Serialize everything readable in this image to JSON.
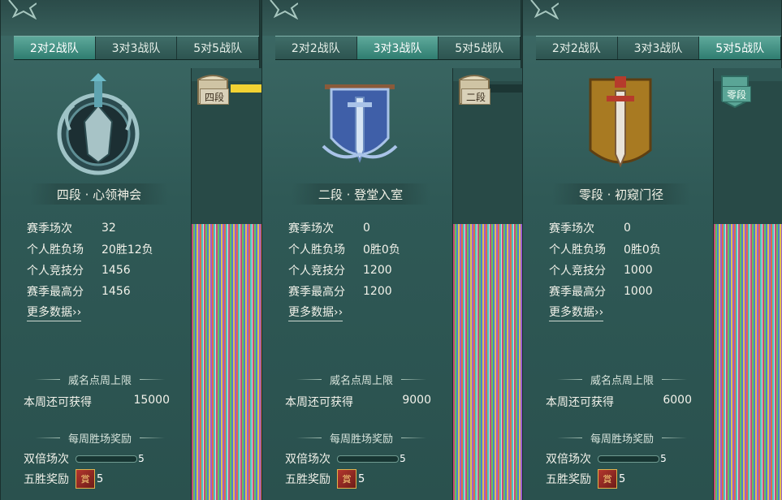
{
  "tabs": [
    "2对2战队",
    "3对3战队",
    "5对5战队"
  ],
  "panels": [
    {
      "active_tab": 0,
      "rank_title": "四段 · 心领神会",
      "emblem": "dark-crest-emblem",
      "chest_label": "四段",
      "stats": [
        {
          "label": "赛季场次",
          "value": "32"
        },
        {
          "label": "个人胜负场",
          "value": "20胜12负"
        },
        {
          "label": "个人竞技分",
          "value": "1456"
        },
        {
          "label": "赛季最高分",
          "value": "1456"
        }
      ],
      "more_link": "更多数据››",
      "weekly_cap_title": "威名点周上限",
      "weekly_remaining_label": "本周还可获得",
      "weekly_remaining_value": "15000",
      "weekly_reward_title": "每周胜场奖励",
      "double_label": "双倍场次",
      "double_progress": 0.0,
      "double_max": "5",
      "five_win_label": "五胜奖励",
      "reward_count": "5"
    },
    {
      "active_tab": 1,
      "rank_title": "二段 · 登堂入室",
      "emblem": "blue-banner-sword-emblem",
      "chest_label": "二段",
      "stats": [
        {
          "label": "赛季场次",
          "value": "0"
        },
        {
          "label": "个人胜负场",
          "value": "0胜0负"
        },
        {
          "label": "个人竞技分",
          "value": "1200"
        },
        {
          "label": "赛季最高分",
          "value": "1200"
        }
      ],
      "more_link": "更多数据››",
      "weekly_cap_title": "威名点周上限",
      "weekly_remaining_label": "本周还可获得",
      "weekly_remaining_value": "9000",
      "weekly_reward_title": "每周胜场奖励",
      "double_label": "双倍场次",
      "double_progress": 0.0,
      "double_max": "5",
      "five_win_label": "五胜奖励",
      "reward_count": "5"
    },
    {
      "active_tab": 2,
      "rank_title": "零段 · 初窥门径",
      "emblem": "gold-banner-sword-emblem",
      "chest_label": "零段",
      "stats": [
        {
          "label": "赛季场次",
          "value": "0"
        },
        {
          "label": "个人胜负场",
          "value": "0胜0负"
        },
        {
          "label": "个人竞技分",
          "value": "1000"
        },
        {
          "label": "赛季最高分",
          "value": "1000"
        }
      ],
      "more_link": "更多数据››",
      "weekly_cap_title": "威名点周上限",
      "weekly_remaining_label": "本周还可获得",
      "weekly_remaining_value": "6000",
      "weekly_reward_title": "每周胜场奖励",
      "double_label": "双倍场次",
      "double_progress": 0.0,
      "double_max": "5",
      "five_win_label": "五胜奖励",
      "reward_count": "5"
    }
  ],
  "colors": {
    "active_tab": "#2f7d70",
    "panel_bg": "#2f5956",
    "yellow_marker": "#f2d233"
  }
}
